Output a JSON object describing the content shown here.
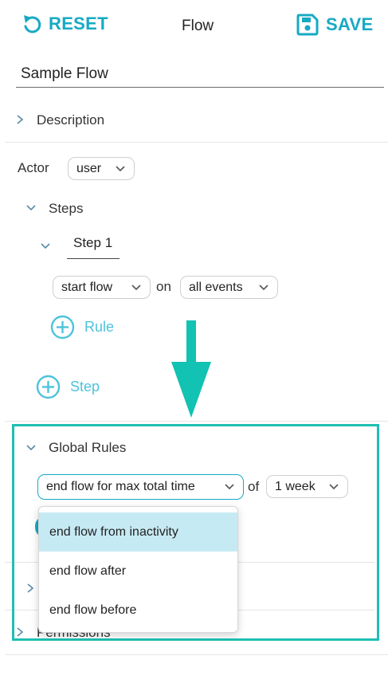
{
  "toolbar": {
    "reset_label": "RESET",
    "title": "Flow",
    "save_label": "SAVE"
  },
  "flow": {
    "name": "Sample Flow"
  },
  "description": {
    "label": "Description"
  },
  "actor": {
    "label": "Actor",
    "value": "user"
  },
  "steps": {
    "label": "Steps",
    "items": [
      {
        "name": "Step 1",
        "trigger": "start flow",
        "connector": "on",
        "event": "all events",
        "add_rule_label": "Rule"
      }
    ],
    "add_step_label": "Step"
  },
  "global_rules": {
    "label": "Global Rules",
    "rule": "end flow for max total time",
    "connector": "of",
    "duration": "1 week",
    "options": [
      "end flow from inactivity",
      "end flow after",
      "end flow before"
    ],
    "highlighted_option": 0
  },
  "permissions": {
    "label": "Permissions"
  },
  "colors": {
    "accent": "#17a9c4",
    "accent_light": "#4cc3dc",
    "highlight_frame": "#1fbfb2",
    "arrow": "#12c2b2",
    "option_highlight": "#c6eaf3"
  },
  "icons": {
    "reset": "undo-icon",
    "save": "floppy-disk-icon",
    "expand": "chevron-icon",
    "add": "plus-circle-icon",
    "annotation": "down-arrow-icon"
  }
}
